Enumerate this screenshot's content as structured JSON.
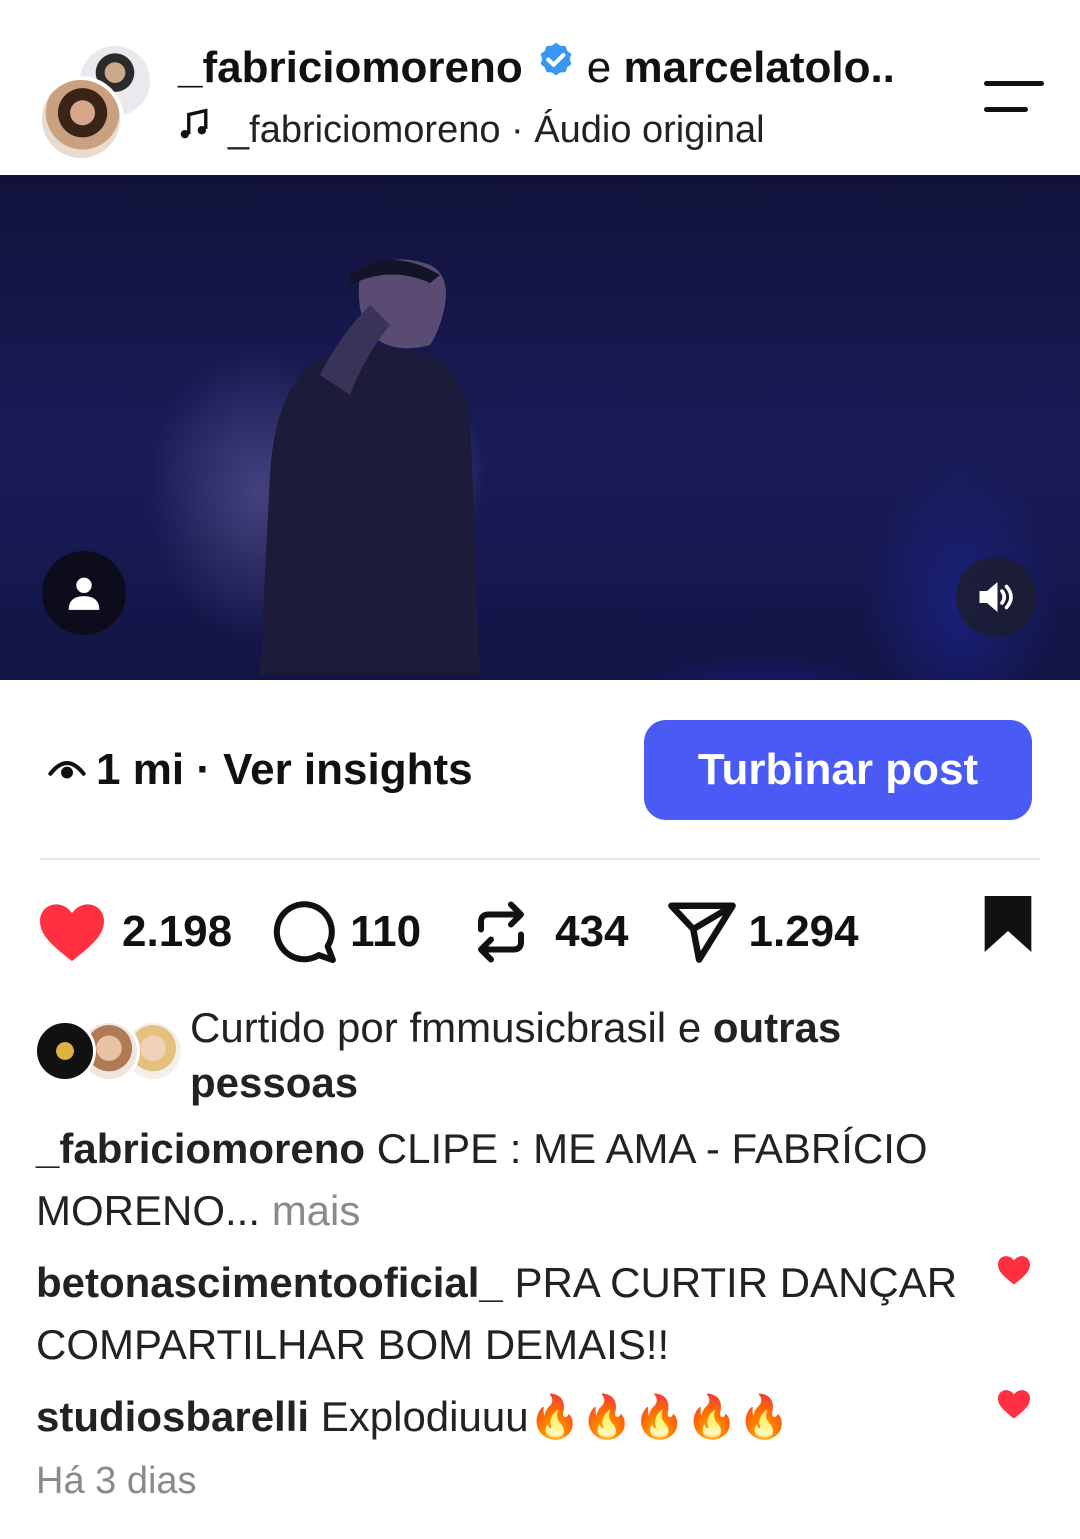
{
  "header": {
    "username": "_fabriciomoreno",
    "joiner": "e",
    "collaborator": "marcelatolo..",
    "audio_user": "_fabriciomoreno",
    "audio_separator": "·",
    "audio_label": "Áudio original"
  },
  "insights": {
    "views": "1 mi",
    "separator": "·",
    "link": "Ver insights",
    "boost_label": "Turbinar post"
  },
  "actions": {
    "likes": "2.198",
    "comments": "110",
    "reposts": "434",
    "shares": "1.294"
  },
  "liked_by": {
    "prefix": "Curtido por",
    "user": "fmmusicbrasil",
    "joiner": "e",
    "others": "outras pessoas"
  },
  "caption": {
    "user": "_fabriciomoreno",
    "text": "CLIPE : ME AMA - FABRÍCIO MORENO...",
    "more": "mais"
  },
  "comments": [
    {
      "user": "betonascimentooficial_",
      "text": "PRA CURTIR DANÇAR  COMPARTILHAR BOM DEMAIS!!"
    },
    {
      "user": "studiosbarelli",
      "text": "Explodiuuu🔥🔥🔥🔥🔥"
    }
  ],
  "timestamp": "Há 3 dias",
  "colors": {
    "accent": "#4a5bf5",
    "like_red": "#ff3040",
    "verified_blue": "#3897f0",
    "muted_gray": "#8a8a8a"
  }
}
